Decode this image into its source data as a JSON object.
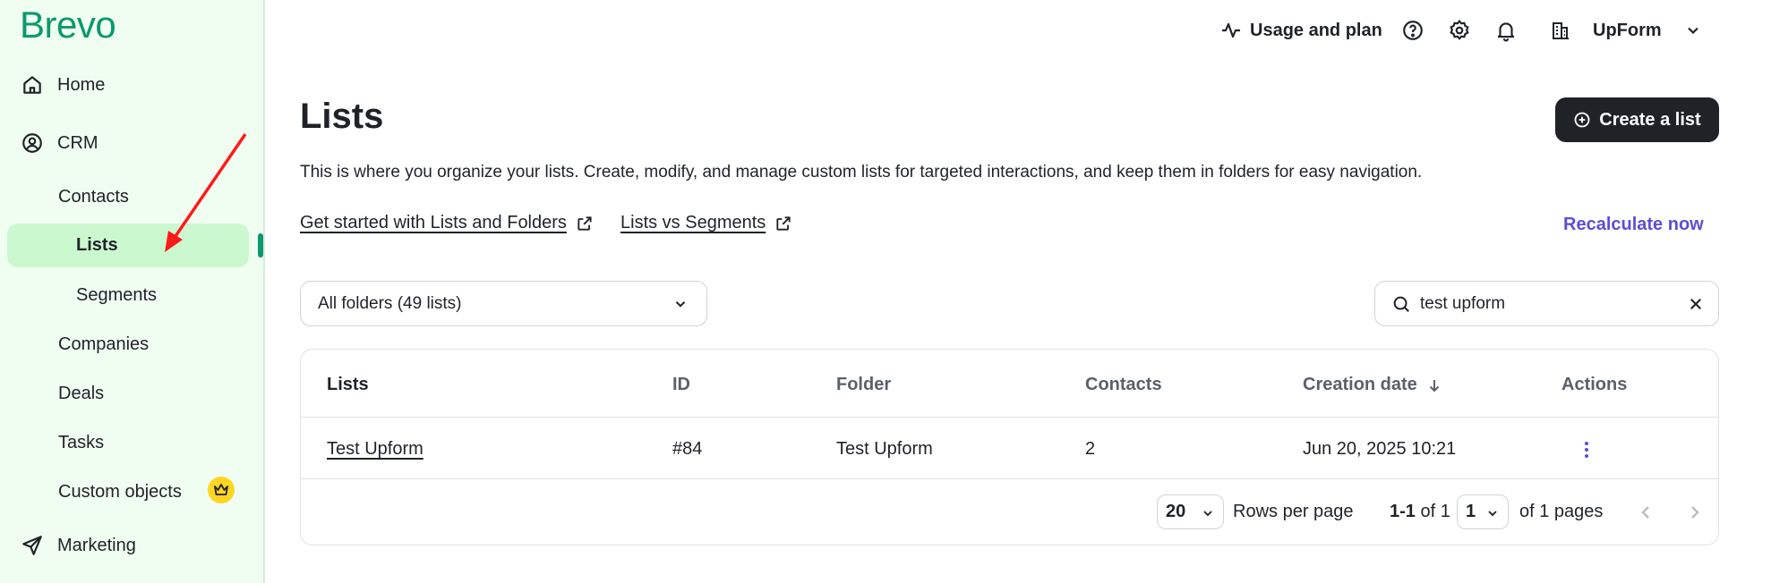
{
  "app": {
    "logo_text": "Brevo",
    "accent_color": "#0b996e",
    "link_color": "#5a4fd6"
  },
  "sidebar": {
    "home": {
      "label": "Home",
      "icon": "home-icon"
    },
    "crm": {
      "label": "CRM",
      "icon": "user-circle-icon"
    },
    "contacts": "Contacts",
    "lists": "Lists",
    "segments": "Segments",
    "companies": "Companies",
    "deals": "Deals",
    "tasks": "Tasks",
    "custom_objects": {
      "label": "Custom objects",
      "badge_icon": "crown-icon"
    },
    "marketing": {
      "label": "Marketing",
      "icon": "send-icon"
    }
  },
  "topbar": {
    "usage_label": "Usage and plan",
    "account_name": "UpForm"
  },
  "main": {
    "title": "Lists",
    "description": "This is where you organize your lists. Create, modify, and manage custom lists for targeted interactions, and keep them in folders for easy navigation.",
    "create_button": "Create a list",
    "links": {
      "get_started": "Get started with Lists and Folders",
      "lists_vs_segments": "Lists vs Segments",
      "recalculate": "Recalculate now"
    },
    "folder_filter": "All folders (49 lists)",
    "search": {
      "value": "test upform"
    }
  },
  "table": {
    "headers": {
      "lists": "Lists",
      "id": "ID",
      "folder": "Folder",
      "contacts": "Contacts",
      "creation_date": "Creation date",
      "actions": "Actions"
    },
    "rows": [
      {
        "name": "Test Upform",
        "id": "#84",
        "folder": "Test Upform",
        "contacts": "2",
        "created": "Jun 20, 2025 10:21"
      }
    ],
    "pagination": {
      "rows_per_page_value": "20",
      "rows_per_page_label": "Rows per page",
      "range_bold": "1-1",
      "range_rest": "of 1",
      "page_value": "1",
      "pages_label": "of 1 pages"
    }
  }
}
